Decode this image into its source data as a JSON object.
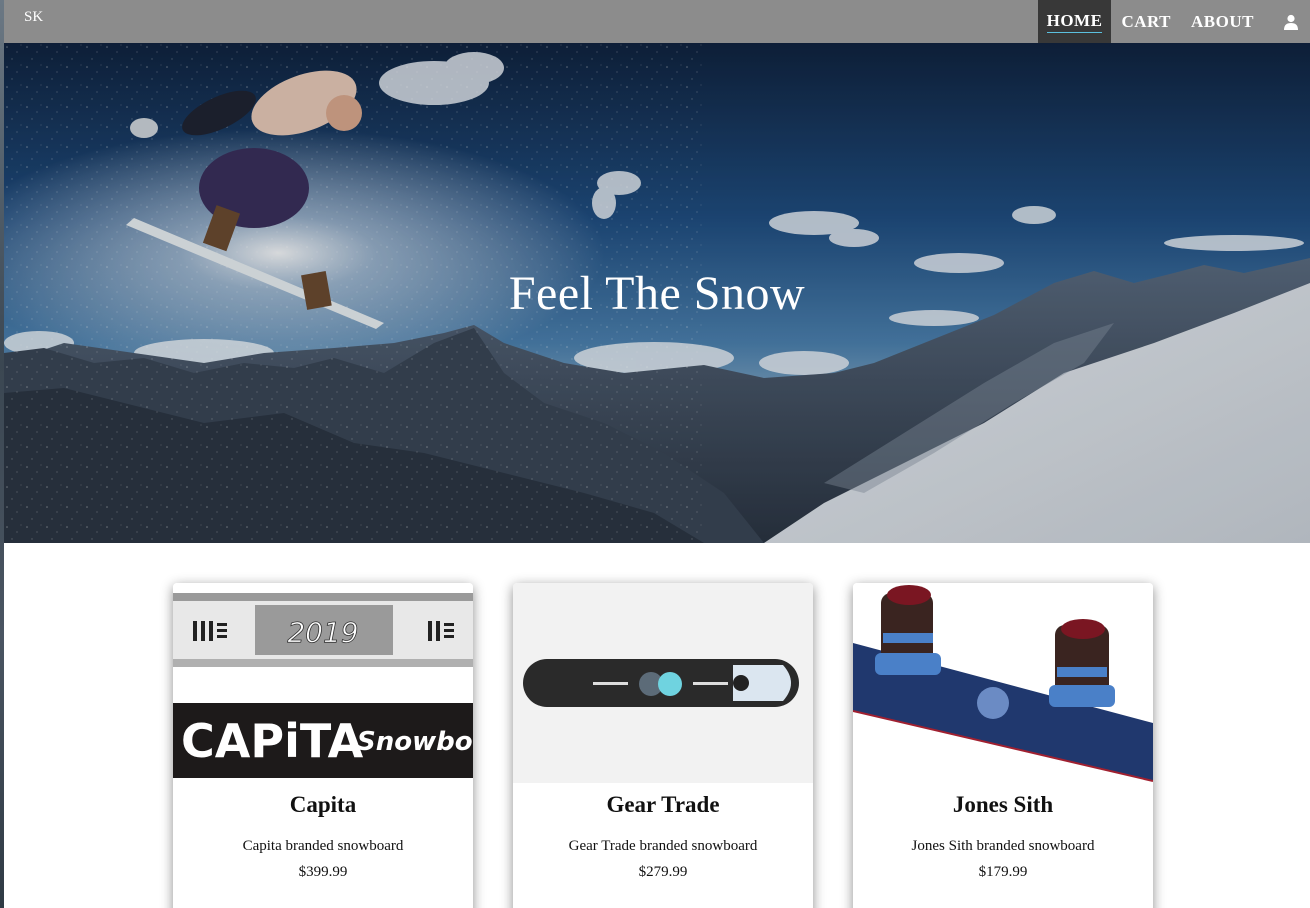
{
  "navbar": {
    "brand": "SK",
    "links": [
      {
        "label": "HOME",
        "active": true
      },
      {
        "label": "CART",
        "active": false
      },
      {
        "label": "ABOUT",
        "active": false
      }
    ],
    "user_icon": "user-icon"
  },
  "hero": {
    "title": "Feel The Snow"
  },
  "products": [
    {
      "name": "Capita",
      "description": "Capita branded snowboard",
      "price": "$399.99",
      "image_text_year": "2019",
      "image_text_brand": "CAPiTA",
      "image_text_word": "Snowboa"
    },
    {
      "name": "Gear Trade",
      "description": "Gear Trade branded snowboard",
      "price": "$279.99"
    },
    {
      "name": "Jones Sith",
      "description": "Jones Sith branded snowboard",
      "price": "$179.99"
    }
  ],
  "colors": {
    "navbar_bg": "#8c8c8c",
    "nav_active_bg": "#383838",
    "nav_underline": "#5bc0de"
  }
}
